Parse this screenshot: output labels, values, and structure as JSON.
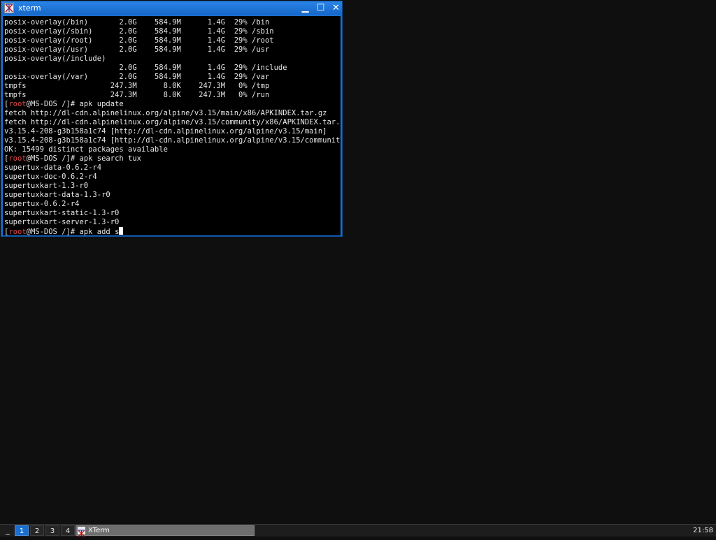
{
  "window": {
    "title": "xterm",
    "minimize_glyph": "▁",
    "maximize_glyph": "☐",
    "close_glyph": "✕"
  },
  "terminal": {
    "lines": [
      "posix-overlay(/bin)       2.0G    584.9M      1.4G  29% /bin",
      "posix-overlay(/sbin)      2.0G    584.9M      1.4G  29% /sbin",
      "posix-overlay(/root)      2.0G    584.9M      1.4G  29% /root",
      "posix-overlay(/usr)       2.0G    584.9M      1.4G  29% /usr",
      "posix-overlay(/include)",
      "                          2.0G    584.9M      1.4G  29% /include",
      "posix-overlay(/var)       2.0G    584.9M      1.4G  29% /var",
      "tmpfs                   247.3M      8.0K    247.3M   0% /tmp",
      "tmpfs                   247.3M      8.0K    247.3M   0% /run"
    ],
    "prompt_user": "root",
    "prompt_host": "@MS-DOS /",
    "prompt_suffix": "]# ",
    "cmd1": "apk update",
    "update_output": [
      "fetch http://dl-cdn.alpinelinux.org/alpine/v3.15/main/x86/APKINDEX.tar.gz",
      "fetch http://dl-cdn.alpinelinux.org/alpine/v3.15/community/x86/APKINDEX.tar.gz",
      "v3.15.4-208-g3b158a1c74 [http://dl-cdn.alpinelinux.org/alpine/v3.15/main]",
      "v3.15.4-208-g3b158a1c74 [http://dl-cdn.alpinelinux.org/alpine/v3.15/community]",
      "OK: 15499 distinct packages available"
    ],
    "cmd2": "apk search tux",
    "search_output": [
      "supertux-data-0.6.2-r4",
      "supertux-doc-0.6.2-r4",
      "supertuxkart-1.3-r0",
      "supertuxkart-data-1.3-r0",
      "supertux-0.6.2-r4",
      "supertuxkart-static-1.3-r0",
      "supertuxkart-server-1.3-r0"
    ],
    "cmd3": "apk add s"
  },
  "taskbar": {
    "menu_glyph": "_",
    "desktops": [
      "1",
      "2",
      "3",
      "4"
    ],
    "active_desktop": "1",
    "task_label": "XTerm",
    "clock": "21:58"
  },
  "colors": {
    "titlebar": "#1a6fd1",
    "prompt_user": "#e04848",
    "desktop_bg": "#0f0f0f"
  }
}
